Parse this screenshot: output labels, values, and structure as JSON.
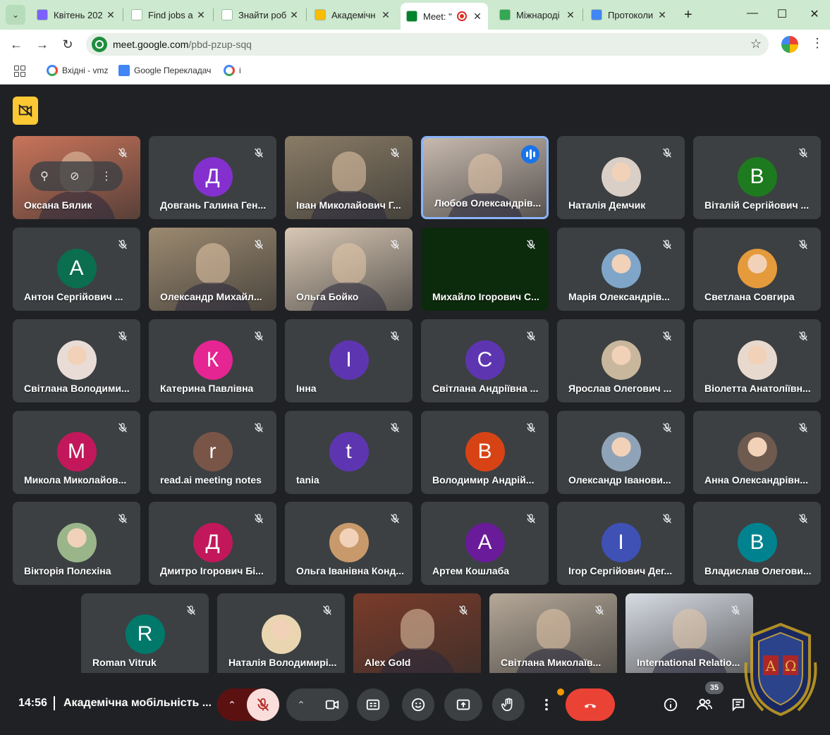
{
  "browser": {
    "tabs": [
      {
        "title": "Квітень 202",
        "active": false,
        "icon_color": "#7b61ff"
      },
      {
        "title": "Find jobs a",
        "active": false,
        "icon_color": "#ffffff"
      },
      {
        "title": "Знайти роб",
        "active": false,
        "icon_color": "#ffffff"
      },
      {
        "title": "Академічн",
        "active": false,
        "icon_color": "#fbbc04"
      },
      {
        "title": "Meet: \"",
        "active": true,
        "icon_color": "#00832d"
      },
      {
        "title": "Міжнароді",
        "active": false,
        "icon_color": "#34a853"
      },
      {
        "title": "Протоколи",
        "active": false,
        "icon_color": "#4285f4"
      }
    ],
    "new_tab_label": "+",
    "url_host": "meet.google.com",
    "url_path": "/pbd-pzup-sqq",
    "bookmarks": [
      {
        "label": "Вхідні - vmz",
        "icon": "google-icon"
      },
      {
        "label": "Google Перекладач",
        "icon": "translate-icon"
      },
      {
        "label": "і",
        "icon": "google-icon"
      }
    ]
  },
  "participants": [
    {
      "name": "Оксана Бялик",
      "type": "video",
      "bg": "#c9745a"
    },
    {
      "name": "Довгань Галина Ген...",
      "type": "letter",
      "letter": "Д",
      "color": "#8430ce"
    },
    {
      "name": "Іван Миколайович Г...",
      "type": "video",
      "bg": "#8a7c66"
    },
    {
      "name": "Любов Олександрів...",
      "type": "video",
      "bg": "#c7b9ae",
      "speaking": true
    },
    {
      "name": "Наталія Демчик",
      "type": "photo",
      "bg": "#d9cfc7"
    },
    {
      "name": "Віталій Сергійович ...",
      "type": "letter",
      "letter": "В",
      "color": "#1e7a1e"
    },
    {
      "name": "Антон Сергійович ...",
      "type": "letter",
      "letter": "А",
      "color": "#0b6e4f"
    },
    {
      "name": "Олександр Михайл...",
      "type": "video",
      "bg": "#9c8a70"
    },
    {
      "name": "Ольга Бойко",
      "type": "video",
      "bg": "#d8c7b4"
    },
    {
      "name": "Михайло Ігорович С...",
      "type": "dark",
      "bg": "#0c2a0c"
    },
    {
      "name": "Марія Олександрів...",
      "type": "photo",
      "bg": "#7fa6c9"
    },
    {
      "name": "Светлана Совгира",
      "type": "photo",
      "bg": "#e59a3b"
    },
    {
      "name": "Світлана Володими...",
      "type": "photo",
      "bg": "#e9dcd6"
    },
    {
      "name": "Катерина Павлівна",
      "type": "letter",
      "letter": "К",
      "color": "#e52592"
    },
    {
      "name": "Інна",
      "type": "letter",
      "letter": "І",
      "color": "#5e35b1"
    },
    {
      "name": "Світлана Андріївна ...",
      "type": "letter",
      "letter": "С",
      "color": "#5e35b1"
    },
    {
      "name": "Ярослав Олегович ...",
      "type": "photo",
      "bg": "#c9b79d"
    },
    {
      "name": "Віолетта Анатоліївн...",
      "type": "photo",
      "bg": "#e8d9cf"
    },
    {
      "name": "Микола Миколайов...",
      "type": "letter",
      "letter": "М",
      "color": "#c2185b"
    },
    {
      "name": "read.ai meeting notes",
      "type": "letter",
      "letter": "r",
      "color": "#795548"
    },
    {
      "name": "tania",
      "type": "letter",
      "letter": "t",
      "color": "#5e35b1"
    },
    {
      "name": "Володимир Андрій...",
      "type": "letter",
      "letter": "В",
      "color": "#d84315"
    },
    {
      "name": "Олександр Іванови...",
      "type": "photo",
      "bg": "#8fa3b8"
    },
    {
      "name": "Анна Олександрівн...",
      "type": "photo",
      "bg": "#6e5a4e"
    },
    {
      "name": "Вікторія Полєхіна",
      "type": "photo",
      "bg": "#9bb58a"
    },
    {
      "name": "Дмитро Ігорович Бі...",
      "type": "letter",
      "letter": "Д",
      "color": "#c2185b"
    },
    {
      "name": "Ольга Іванівна Конд...",
      "type": "photo",
      "bg": "#c89a6b"
    },
    {
      "name": "Артем Кошлаба",
      "type": "letter",
      "letter": "А",
      "color": "#6a1b9a"
    },
    {
      "name": "Ігор Сергійович Дег...",
      "type": "letter",
      "letter": "І",
      "color": "#3f51b5"
    },
    {
      "name": "Владислав Олегови...",
      "type": "letter",
      "letter": "В",
      "color": "#00838f"
    },
    {
      "name": "Roman Vitruk",
      "type": "letter",
      "letter": "R",
      "color": "#00796b"
    },
    {
      "name": "Наталія Володимирі...",
      "type": "photo",
      "bg": "#e9d6b0"
    },
    {
      "name": "Alex Gold",
      "type": "video",
      "bg": "#7a3b2a"
    },
    {
      "name": "Світлана Миколаїв...",
      "type": "video",
      "bg": "#b5a898"
    },
    {
      "name": "International Relatio...",
      "type": "video",
      "bg": "#d7dbe3"
    }
  ],
  "bottom": {
    "time": "14:56",
    "meeting_title": "Академічна мобільність ...",
    "people_count": "35",
    "end_call_label": "end call"
  }
}
